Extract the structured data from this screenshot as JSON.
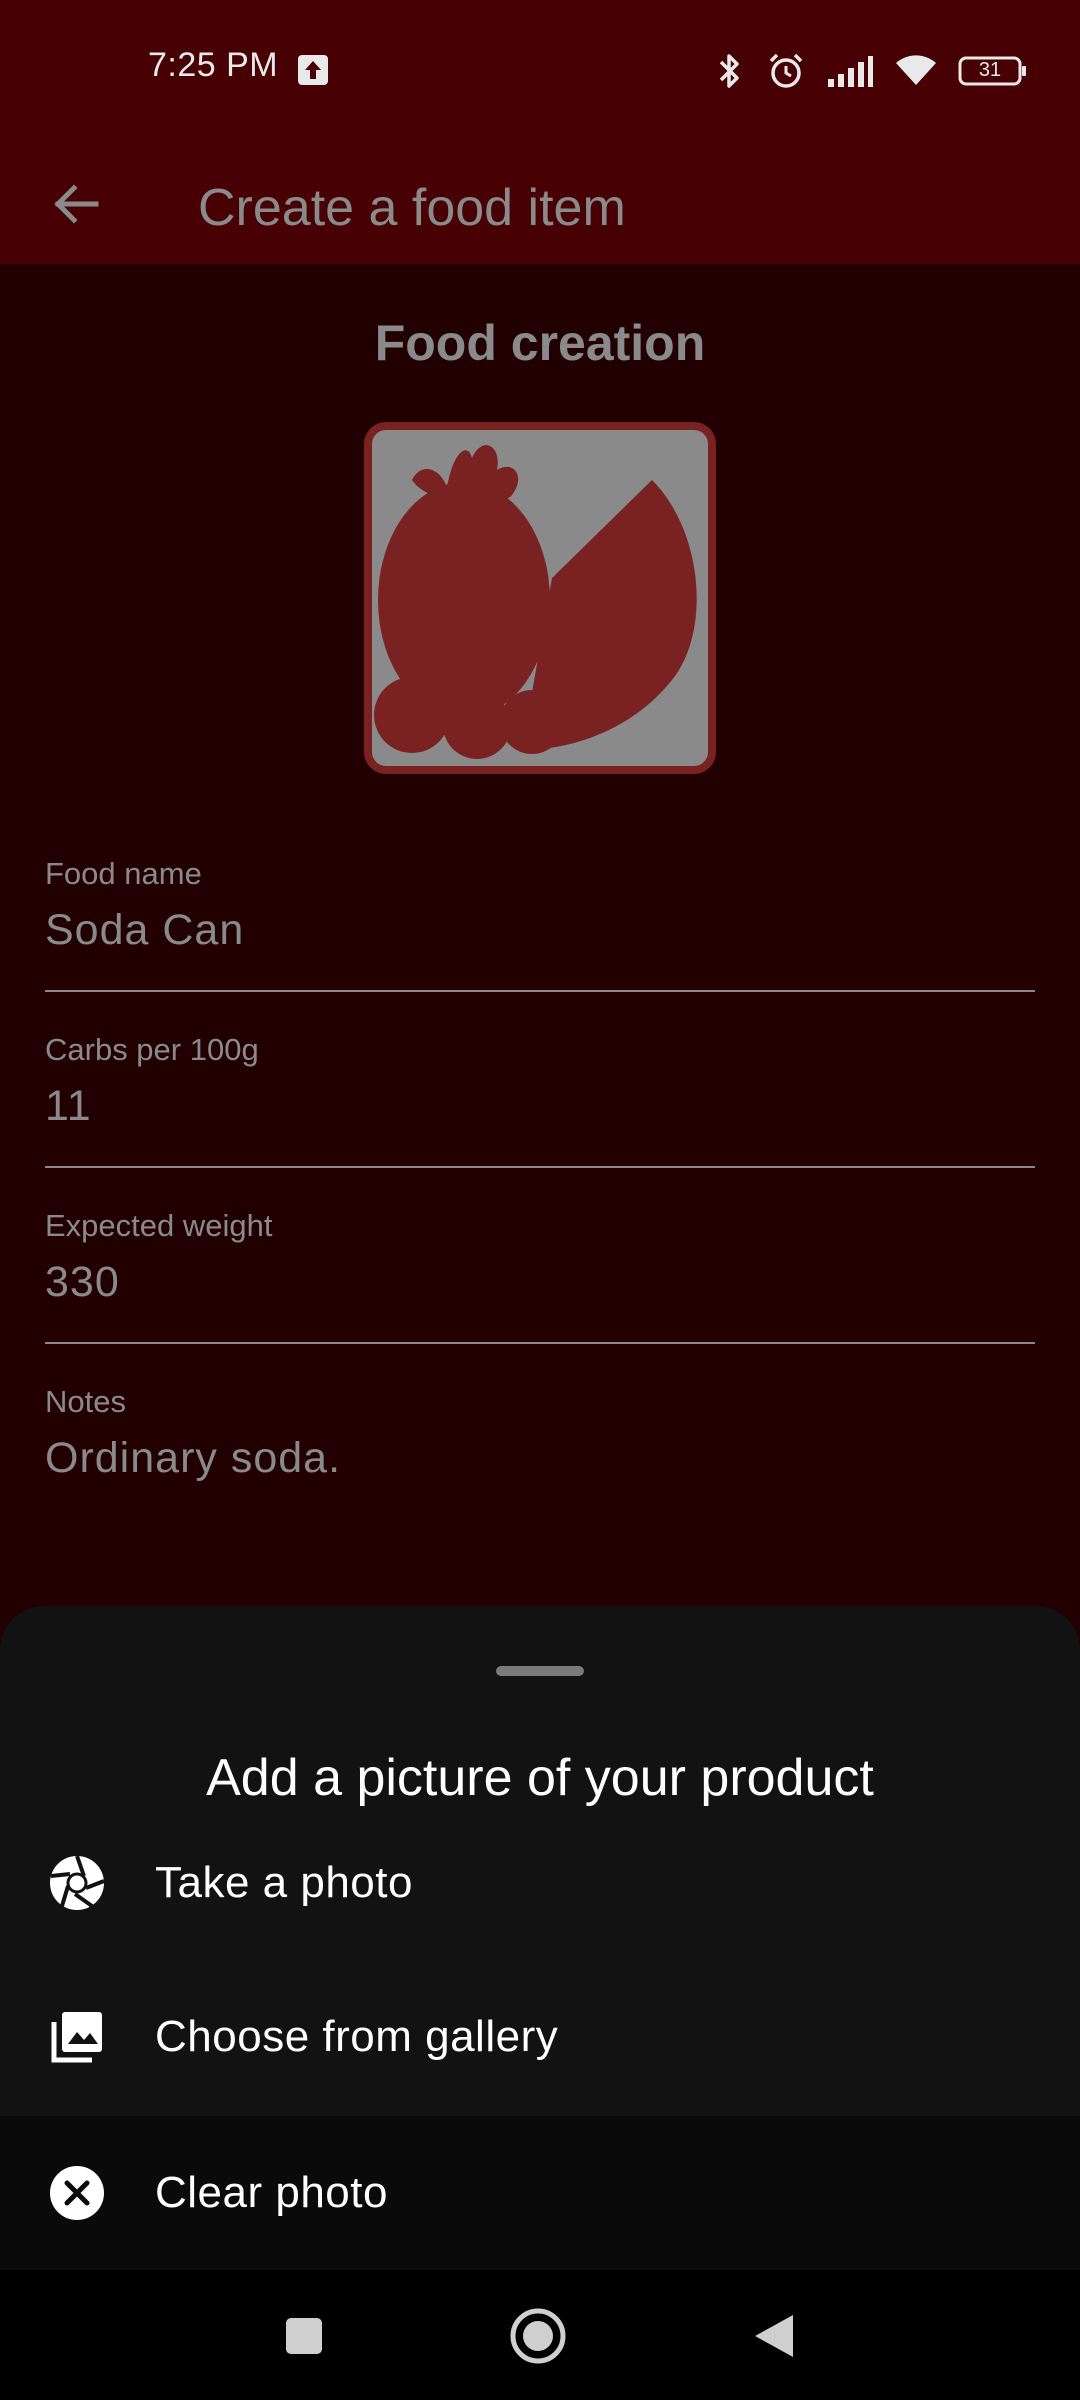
{
  "status_bar": {
    "time": "7:25 PM",
    "battery": "31",
    "icons": [
      "upload-icon",
      "bluetooth-icon",
      "alarm-icon",
      "signal-icon",
      "wifi-icon",
      "battery-icon"
    ]
  },
  "app_bar": {
    "title": "Create a food item",
    "back_icon": "arrow-left-icon"
  },
  "content": {
    "section_title": "Food creation",
    "image_icon": "fruit-placeholder-icon",
    "fields": [
      {
        "label": "Food name",
        "value": "Soda Can"
      },
      {
        "label": "Carbs per 100g",
        "value": "11"
      },
      {
        "label": "Expected weight",
        "value": "330"
      },
      {
        "label": "Notes",
        "value": "Ordinary soda."
      }
    ]
  },
  "sheet": {
    "title": "Add a picture of your product",
    "items": [
      {
        "label": "Take a photo",
        "icon": "camera-shutter-icon"
      },
      {
        "label": "Choose from gallery",
        "icon": "gallery-icon"
      },
      {
        "label": "Clear photo",
        "icon": "close-circle-icon"
      }
    ]
  },
  "nav_bar": {
    "buttons": [
      "recents-square-icon",
      "home-circle-icon",
      "back-triangle-icon"
    ]
  },
  "colors": {
    "app_bar": "#470003",
    "scrim_background": "#220002",
    "sheet_background": "#121212",
    "image_border": "#7a2222"
  }
}
